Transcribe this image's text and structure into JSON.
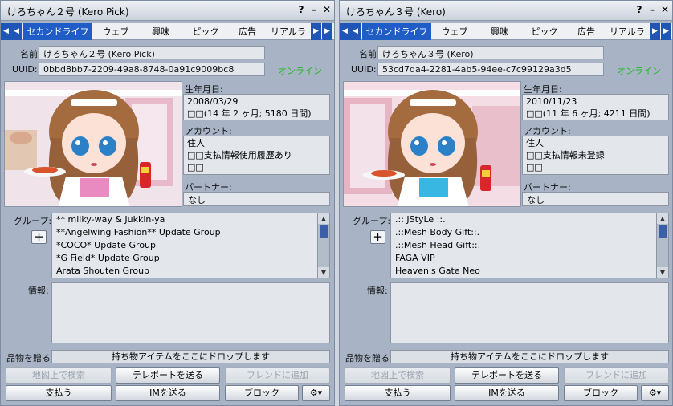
{
  "panels": [
    {
      "title": "けろちゃん２号 (Kero Pick)",
      "help": "?",
      "minimize": "–",
      "close": "✕",
      "tabs": [
        "セカンドライフ",
        "ウェブ",
        "興味",
        "ピック",
        "広告",
        "リアルラ"
      ],
      "active_tab": 0,
      "name_label": "名前:",
      "name": "けろちゃん２号 (Kero Pick)",
      "uuid_label": "UUID:",
      "uuid": "0bbd8bb7-2209-49a8-8748-0a91c9009bc8",
      "status": "オンライン",
      "born_label": "生年月日:",
      "born_lines": [
        "2008/03/29",
        "□□(14 年 2 ヶ月; 5180 日間)"
      ],
      "account_label": "アカウント:",
      "account_lines": [
        "住人",
        "□□支払情報使用履歴あり",
        "□□"
      ],
      "partner_label": "パートナー:",
      "partner": "なし",
      "groups_label": "グループ:",
      "add_group": "+",
      "groups": [
        "** milky-way & Jukkin-ya",
        "**Angelwing Fashion** Update Group",
        "*COCO* Update Group",
        "*G Field* Update Group",
        "Arata Shouten Group"
      ],
      "info_label": "情報:",
      "info": "",
      "give_label": "品物を贈る:",
      "drop_text": "持ち物アイテムをここにドロップします",
      "buttons_row1": [
        "地図上で検索",
        "テレポートを送る",
        "フレンドに追加"
      ],
      "buttons_row2": [
        "支払う",
        "IMを送る",
        "ブロック",
        "⚙▾"
      ],
      "photo_bg": "#f1e3ea",
      "apron_color": "#e98ac0"
    },
    {
      "title": "けろちゃん３号 (Kero)",
      "help": "?",
      "minimize": "–",
      "close": "✕",
      "tabs": [
        "セカンドライフ",
        "ウェブ",
        "興味",
        "ピック",
        "広告",
        "リアルラ"
      ],
      "active_tab": 0,
      "name_label": "名前:",
      "name": "けろちゃん３号 (Kero)",
      "uuid_label": "UUID:",
      "uuid": "53cd7da4-2281-4ab5-94ee-c7c99129a3d5",
      "status": "オンライン",
      "born_label": "生年月日:",
      "born_lines": [
        "2010/11/23",
        "□□(11 年 6 ヶ月; 4211 日間)"
      ],
      "account_label": "アカウント:",
      "account_lines": [
        "住人",
        "□□支払情報未登録",
        "□□"
      ],
      "partner_label": "パートナー:",
      "partner": "なし",
      "groups_label": "グループ:",
      "add_group": "+",
      "groups": [
        ".:: JStyLe ::.",
        ".::Mesh Body Gift::.",
        ".::Mesh Head Gift::.",
        "FAGA VIP",
        "Heaven's Gate Neo"
      ],
      "info_label": "情報:",
      "info": "",
      "give_label": "品物を贈る:",
      "drop_text": "持ち物アイテムをここにドロップします",
      "buttons_row1": [
        "地図上で検索",
        "テレポートを送る",
        "フレンドに追加"
      ],
      "buttons_row2": [
        "支払う",
        "IMを送る",
        "ブロック",
        "⚙▾"
      ],
      "photo_bg": "#f4dde4",
      "apron_color": "#39b7e3"
    }
  ]
}
